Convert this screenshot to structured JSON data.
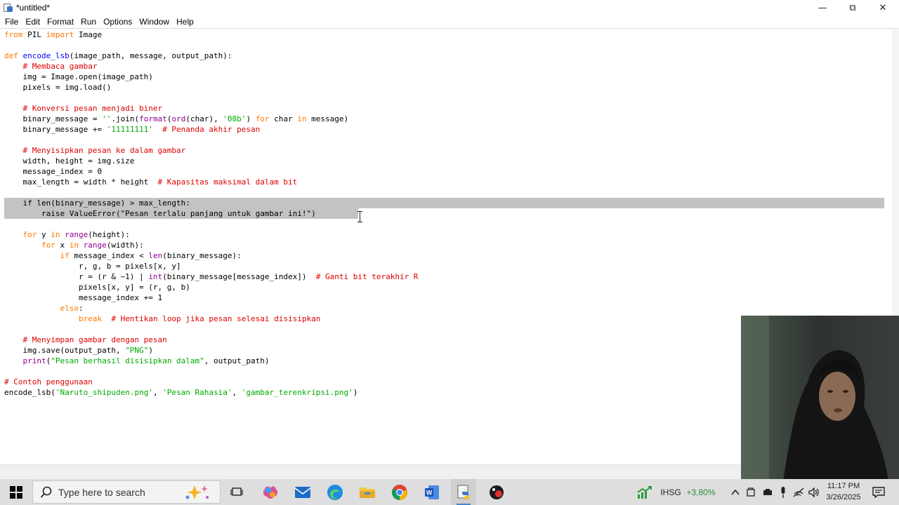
{
  "window": {
    "title": "*untitled*",
    "minimize": "—",
    "maximize": "⧉",
    "close": "✕"
  },
  "menu": [
    "File",
    "Edit",
    "Format",
    "Run",
    "Options",
    "Window",
    "Help"
  ],
  "code_lines": [
    [
      [
        "kw",
        "from"
      ],
      [
        "t",
        " PIL "
      ],
      [
        "kw",
        "import"
      ],
      [
        "t",
        " Image"
      ]
    ],
    [],
    [
      [
        "kw",
        "def"
      ],
      [
        "t",
        " "
      ],
      [
        "fn",
        "encode_lsb"
      ],
      [
        "t",
        "(image_path, message, output_path):"
      ]
    ],
    [
      [
        "t",
        "    "
      ],
      [
        "cm",
        "# Membaca gambar"
      ]
    ],
    [
      [
        "t",
        "    img = Image.open(image_path)"
      ]
    ],
    [
      [
        "t",
        "    pixels = img.load()"
      ]
    ],
    [],
    [
      [
        "t",
        "    "
      ],
      [
        "cm",
        "# Konversi pesan menjadi biner"
      ]
    ],
    [
      [
        "t",
        "    binary_message = "
      ],
      [
        "st",
        "''"
      ],
      [
        "t",
        ".join("
      ],
      [
        "bi",
        "format"
      ],
      [
        "t",
        "("
      ],
      [
        "bi",
        "ord"
      ],
      [
        "t",
        "(char), "
      ],
      [
        "st",
        "'08b'"
      ],
      [
        "t",
        ") "
      ],
      [
        "kw",
        "for"
      ],
      [
        "t",
        " char "
      ],
      [
        "kw",
        "in"
      ],
      [
        "t",
        " message)"
      ]
    ],
    [
      [
        "t",
        "    binary_message += "
      ],
      [
        "st",
        "'11111111'"
      ],
      [
        "t",
        "  "
      ],
      [
        "cm",
        "# Penanda akhir pesan"
      ]
    ],
    [],
    [
      [
        "t",
        "    "
      ],
      [
        "cm",
        "# Menyisipkan pesan ke dalam gambar"
      ]
    ],
    [
      [
        "t",
        "    width, height = img.size"
      ]
    ],
    [
      [
        "t",
        "    message_index = 0"
      ]
    ],
    [
      [
        "t",
        "    max_length = width * height  "
      ],
      [
        "cm",
        "# Kapasitas maksimal dalam bit"
      ]
    ],
    [],
    [
      [
        "t",
        "    if len(binary_message) > max_length:"
      ]
    ],
    [
      [
        "t",
        "        raise ValueError(\"Pesan terlalu panjang untuk gambar ini!\")"
      ]
    ],
    [],
    [
      [
        "t",
        "    "
      ],
      [
        "kw",
        "for"
      ],
      [
        "t",
        " y "
      ],
      [
        "kw",
        "in"
      ],
      [
        "t",
        " "
      ],
      [
        "bi",
        "range"
      ],
      [
        "t",
        "(height):"
      ]
    ],
    [
      [
        "t",
        "        "
      ],
      [
        "kw",
        "for"
      ],
      [
        "t",
        " x "
      ],
      [
        "kw",
        "in"
      ],
      [
        "t",
        " "
      ],
      [
        "bi",
        "range"
      ],
      [
        "t",
        "(width):"
      ]
    ],
    [
      [
        "t",
        "            "
      ],
      [
        "kw",
        "if"
      ],
      [
        "t",
        " message_index < "
      ],
      [
        "bi",
        "len"
      ],
      [
        "t",
        "(binary_message):"
      ]
    ],
    [
      [
        "t",
        "                r, g, b = pixels[x, y]"
      ]
    ],
    [
      [
        "t",
        "                r = (r & ~1) | "
      ],
      [
        "bi",
        "int"
      ],
      [
        "t",
        "(binary_message[message_index])  "
      ],
      [
        "cm",
        "# Ganti bit terakhir R"
      ]
    ],
    [
      [
        "t",
        "                pixels[x, y] = (r, g, b)"
      ]
    ],
    [
      [
        "t",
        "                message_index += 1"
      ]
    ],
    [
      [
        "t",
        "            "
      ],
      [
        "kw",
        "else"
      ],
      [
        "t",
        ":"
      ]
    ],
    [
      [
        "t",
        "                "
      ],
      [
        "kw",
        "break"
      ],
      [
        "t",
        "  "
      ],
      [
        "cm",
        "# Hentikan loop jika pesan selesai disisipkan"
      ]
    ],
    [],
    [
      [
        "t",
        "    "
      ],
      [
        "cm",
        "# Menyimpan gambar dengan pesan"
      ]
    ],
    [
      [
        "t",
        "    img.save(output_path, "
      ],
      [
        "st",
        "\"PNG\""
      ],
      [
        "t",
        ")"
      ]
    ],
    [
      [
        "t",
        "    "
      ],
      [
        "bi",
        "print"
      ],
      [
        "t",
        "("
      ],
      [
        "st",
        "\"Pesan berhasil disisipkan dalam\""
      ],
      [
        "t",
        ", output_path)"
      ]
    ],
    [],
    [
      [
        "cm",
        "# Contoh penggunaan"
      ]
    ],
    [
      [
        "t",
        "encode_lsb("
      ],
      [
        "st",
        "'Naruto_shipuden.png'"
      ],
      [
        "t",
        ", "
      ],
      [
        "st",
        "'Pesan Rahasia'"
      ],
      [
        "t",
        ", "
      ],
      [
        "st",
        "'gambar_terenkripsi.png'"
      ],
      [
        "t",
        ")"
      ]
    ]
  ],
  "taskbar": {
    "search_placeholder": "Type here to search",
    "stock_name": "IHSG",
    "stock_change": "+3,80%",
    "time": "11:17 PM",
    "date": "3/26/2025"
  },
  "colors": {
    "keyword": "#ff7700",
    "builtin": "#900090",
    "function_name": "#0000ff",
    "string": "#00aa00",
    "comment": "#dd0000",
    "selection": "#c3c3c3"
  },
  "icons": [
    "windows-start-icon",
    "search-icon",
    "copilot-icon",
    "task-view-icon",
    "colorful-app-icon",
    "mail-icon",
    "edge-icon",
    "file-explorer-icon",
    "chrome-icon",
    "word-icon",
    "python-idle-icon",
    "game-icon",
    "stock-chart-icon",
    "chevron-up-icon",
    "network-icon",
    "speaker-icon",
    "notification-icon"
  ]
}
